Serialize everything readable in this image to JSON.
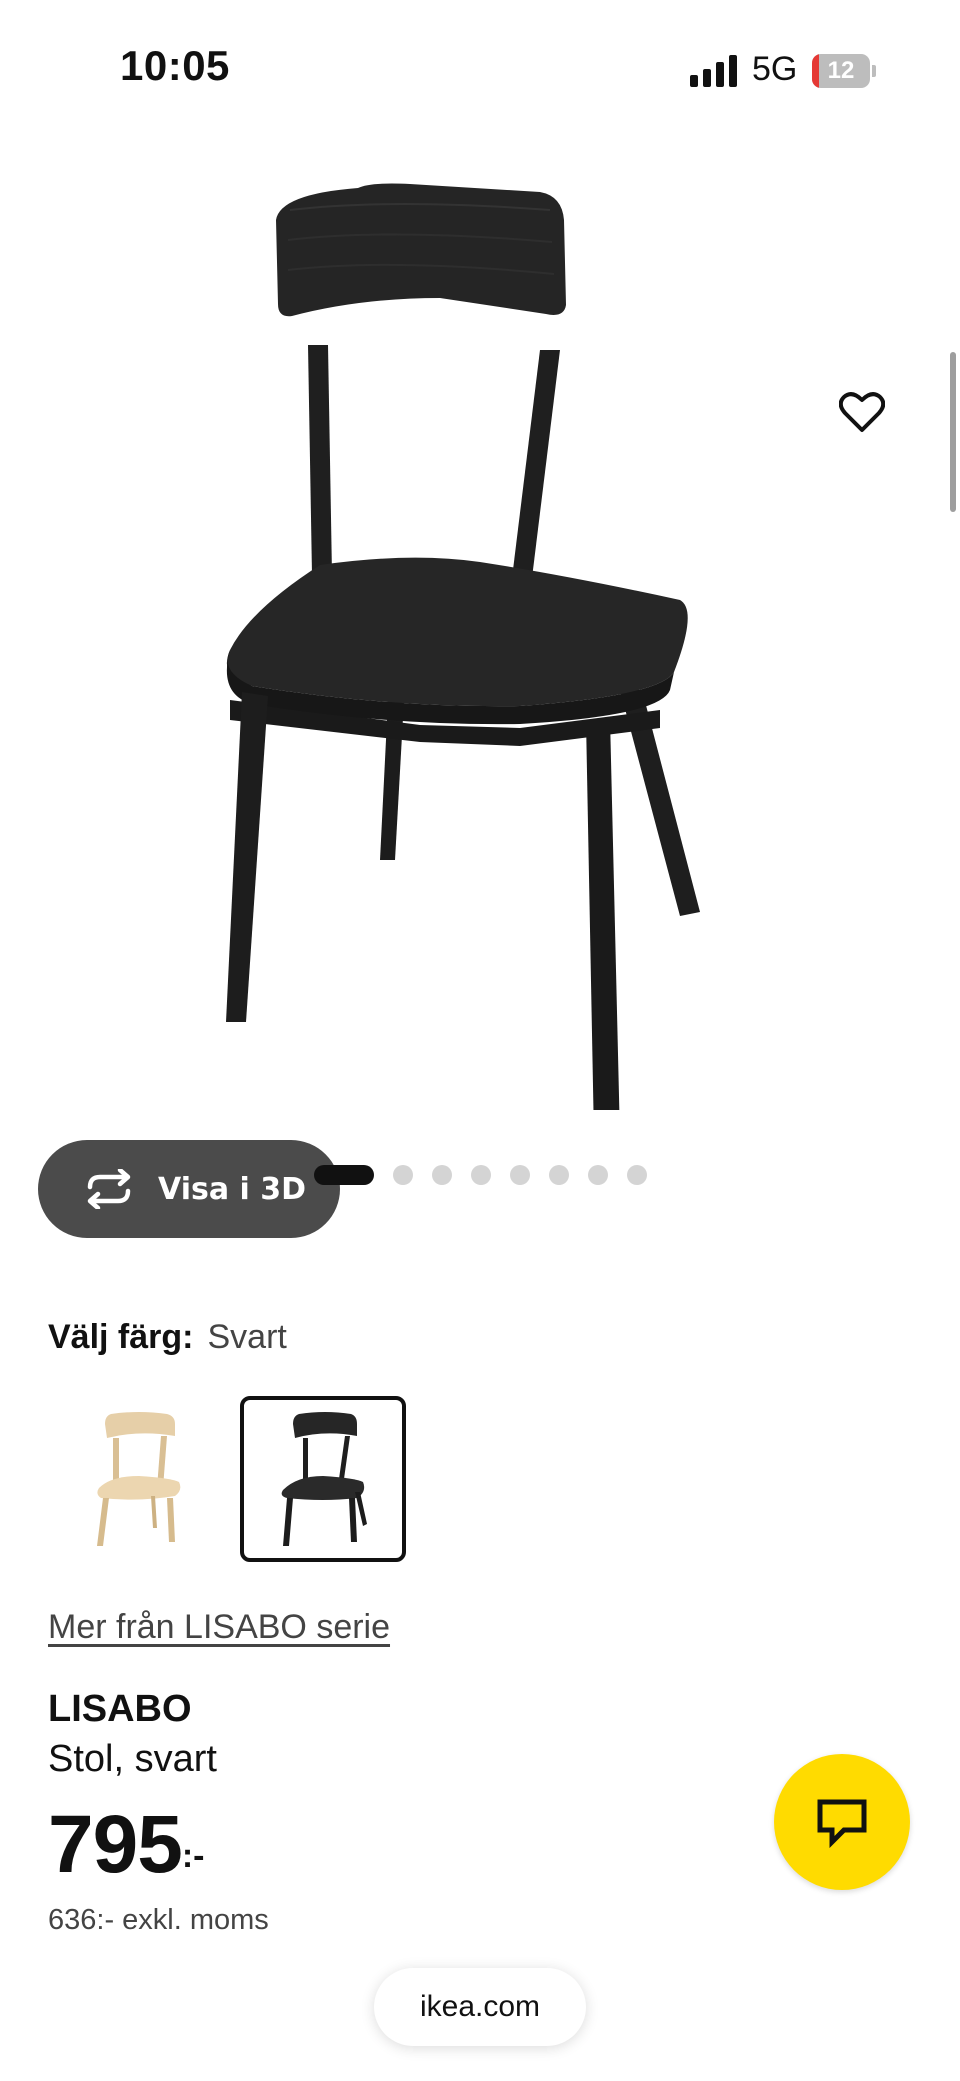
{
  "status_bar": {
    "time": "10:05",
    "network": "5G",
    "battery_percent": "12",
    "battery_color": "#e53935"
  },
  "gallery": {
    "image_icon": "black-chair-product-image",
    "view_3d_label": "Visa i 3D",
    "view_3d_icon": "rotate-3d-icon",
    "favorite_icon": "heart-outline-icon",
    "slide_count": 8,
    "active_slide": 1
  },
  "color_select": {
    "label": "Välj färg:",
    "selected": "Svart",
    "options": [
      {
        "name": "birch-chair-swatch",
        "color": "#e8d2ad"
      },
      {
        "name": "black-chair-swatch",
        "color": "#222222",
        "selected": true
      }
    ]
  },
  "series_link": "Mer från LISABO serie",
  "product": {
    "name": "LISABO",
    "description": "Stol, svart",
    "price": "795",
    "price_suffix": ":-",
    "price_excl_vat": "636:- exkl. moms"
  },
  "chat": {
    "icon": "chat-bubble-icon",
    "color": "#ffdb00"
  },
  "browser": {
    "url": "ikea.com"
  }
}
